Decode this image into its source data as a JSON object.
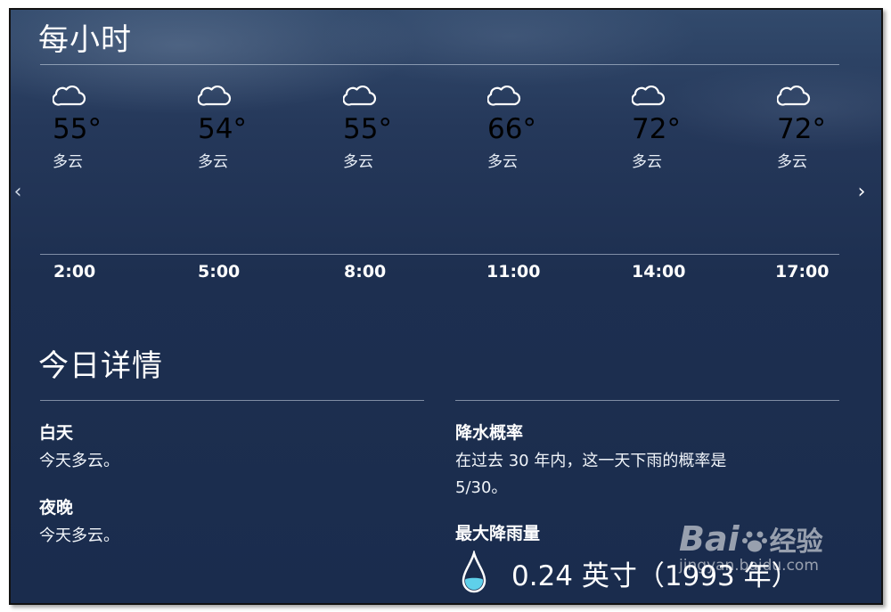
{
  "hourly": {
    "title": "每小时",
    "items": [
      {
        "temp": "55°",
        "condition": "多云",
        "time": "2:00",
        "icon": "cloud-icon"
      },
      {
        "temp": "54°",
        "condition": "多云",
        "time": "5:00",
        "icon": "cloud-icon"
      },
      {
        "temp": "55°",
        "condition": "多云",
        "time": "8:00",
        "icon": "cloud-icon"
      },
      {
        "temp": "66°",
        "condition": "多云",
        "time": "11:00",
        "icon": "cloud-icon"
      },
      {
        "temp": "72°",
        "condition": "多云",
        "time": "14:00",
        "icon": "cloud-icon"
      },
      {
        "temp": "72°",
        "condition": "多云",
        "time": "17:00",
        "icon": "cloud-icon"
      }
    ],
    "prev_icon": "chevron-left-icon",
    "next_icon": "chevron-right-icon"
  },
  "details": {
    "title": "今日详情",
    "day": {
      "label": "白天",
      "text": "今天多云。"
    },
    "night": {
      "label": "夜晚",
      "text": "今天多云。"
    },
    "precip_chance": {
      "label": "降水概率",
      "text_line1": "在过去 30 年内，这一天下雨的概率是",
      "text_line2": "5/30。"
    },
    "max_rain": {
      "label": "最大降雨量",
      "value": "0.24 英寸（1993 年）",
      "icon": "raindrop-icon"
    }
  },
  "watermark": {
    "brand_prefix": "Bai",
    "brand_suffix": "经验",
    "url": "jingyan.baidu.com"
  }
}
